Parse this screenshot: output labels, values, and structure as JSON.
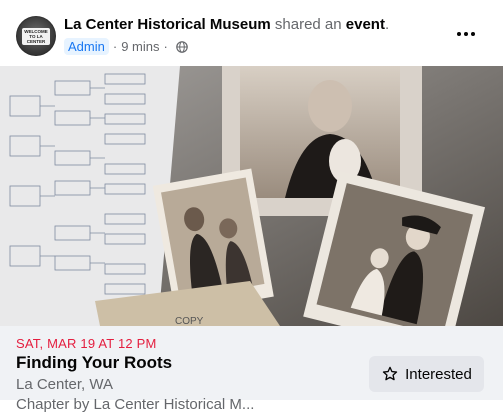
{
  "post": {
    "page_name": "La Center Historical Museum",
    "action_text": "shared an",
    "object_text": "event",
    "object_punct": ".",
    "role_badge": "Admin",
    "separator": "·",
    "time": "9 mins",
    "audience_icon": "globe-icon",
    "more_icon": "more-horizontal-icon",
    "avatar_sign": "WELCOME TO LA CENTER"
  },
  "photo": {
    "copy_stamp": "COPY"
  },
  "event": {
    "date": "SAT, MAR 19 AT 12 PM",
    "title": "Finding Your Roots",
    "location": "La Center, WA",
    "host_partial": "Chapter by La Center Historical M...",
    "interested_label": "Interested",
    "interested_icon": "star-icon"
  },
  "colors": {
    "date_red": "#e41e3f",
    "badge_blue": "#1877f2",
    "card_bg": "#f0f2f5",
    "button_bg": "#e4e6eb"
  }
}
